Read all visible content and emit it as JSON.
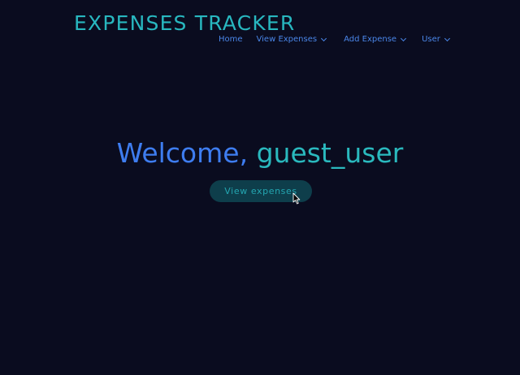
{
  "header": {
    "brand": "EXPENSES TRACKER",
    "nav": [
      {
        "label": "Home",
        "has_dropdown": false
      },
      {
        "label": "View Expenses",
        "has_dropdown": true
      },
      {
        "label": "Add Expense",
        "has_dropdown": true
      },
      {
        "label": "User",
        "has_dropdown": true
      }
    ]
  },
  "main": {
    "welcome_prefix": "Welcome,",
    "username": "guest_user",
    "cta_label": "View expenses"
  },
  "colors": {
    "background": "#0a0c1f",
    "brand": "#28b7bf",
    "nav": "#4a86e8",
    "welcome": "#3e7df0",
    "username": "#2ab9be",
    "button_bg": "#0e3e4b",
    "button_text": "#24a6b1"
  },
  "icons": {
    "dropdown": "chevron-down-icon",
    "pointer": "mouse-pointer-icon"
  }
}
